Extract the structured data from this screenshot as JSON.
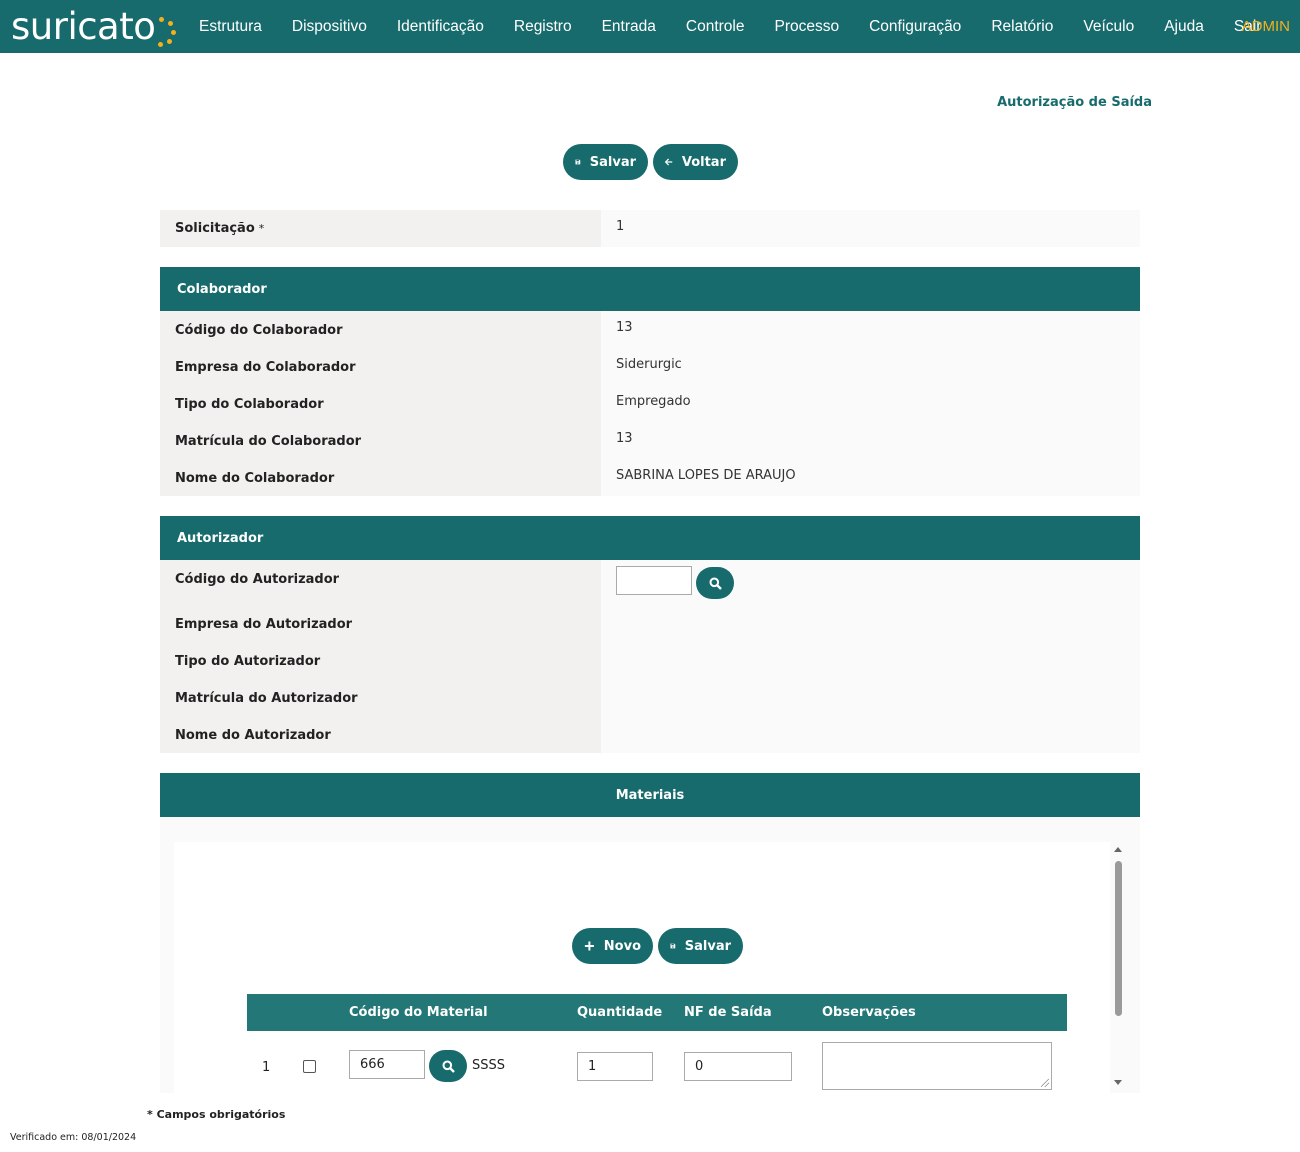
{
  "app": {
    "logo_text": "suricato",
    "user": "ADMIN"
  },
  "nav": [
    "Estrutura",
    "Dispositivo",
    "Identificação",
    "Registro",
    "Entrada",
    "Controle",
    "Processo",
    "Configuração",
    "Relatório",
    "Veículo",
    "Ajuda",
    "Sair"
  ],
  "page": {
    "title": "Autorização de Saída"
  },
  "toolbar": {
    "save_label": "Salvar",
    "back_label": "Voltar"
  },
  "solicitacao": {
    "label": "Solicitação",
    "required_mark": "*",
    "value": "1"
  },
  "colaborador": {
    "heading": "Colaborador",
    "fields": [
      {
        "label": "Código do Colaborador",
        "value": "13"
      },
      {
        "label": "Empresa do Colaborador",
        "value": "Siderurgic"
      },
      {
        "label": "Tipo do Colaborador",
        "value": "Empregado"
      },
      {
        "label": "Matrícula do Colaborador",
        "value": "13"
      },
      {
        "label": "Nome do Colaborador",
        "value": "SABRINA LOPES DE ARAUJO"
      }
    ]
  },
  "autorizador": {
    "heading": "Autorizador",
    "codigo_label": "Código do Autorizador",
    "codigo_value": "",
    "fields": [
      {
        "label": "Empresa do Autorizador",
        "value": ""
      },
      {
        "label": "Tipo do Autorizador",
        "value": ""
      },
      {
        "label": "Matrícula do Autorizador",
        "value": ""
      },
      {
        "label": "Nome do Autorizador",
        "value": ""
      }
    ]
  },
  "materiais": {
    "heading": "Materiais",
    "new_label": "Novo",
    "save_label": "Salvar",
    "columns": [
      "Código do Material",
      "Quantidade",
      "NF de Saída",
      "Observações"
    ],
    "rows": [
      {
        "num": "1",
        "codigo": "666",
        "descricao": "SSSS",
        "quantidade": "1",
        "nf": "0",
        "obs": ""
      }
    ]
  },
  "footer": {
    "required_note": "* Campos obrigatórios",
    "verified": "Verificado em: 08/01/2024"
  }
}
